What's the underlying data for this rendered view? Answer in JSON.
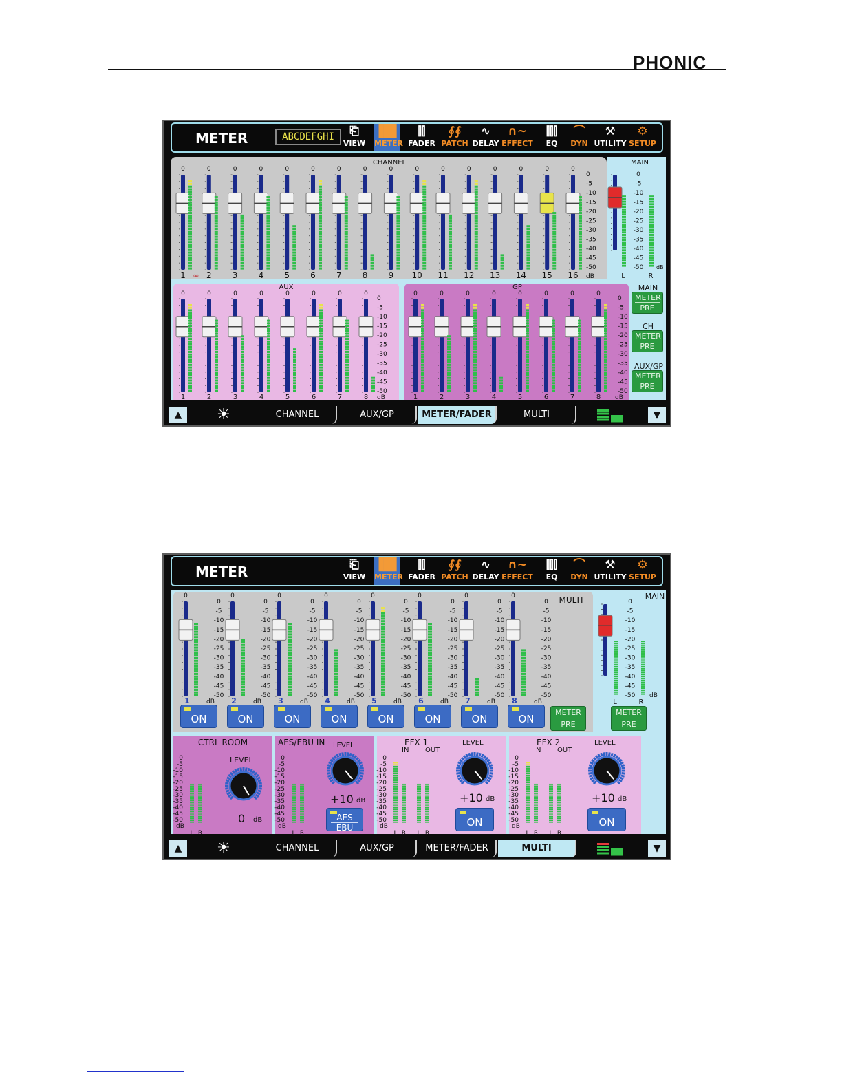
{
  "brand": "PHONIC",
  "toolbar": {
    "title": "METER",
    "channel_name": "ABCDEFGHI",
    "items": [
      {
        "label": "VIEW",
        "icon": "view-icon"
      },
      {
        "label": "METER",
        "icon": "meter-icon"
      },
      {
        "label": "FADER",
        "icon": "fader-icon"
      },
      {
        "label": "PATCH",
        "icon": "patch-icon"
      },
      {
        "label": "DELAY",
        "icon": "delay-icon"
      },
      {
        "label": "EFFECT",
        "icon": "effect-icon"
      },
      {
        "label": "EQ",
        "icon": "eq-icon"
      },
      {
        "label": "DYN",
        "icon": "dyn-icon"
      },
      {
        "label": "UTILITY",
        "icon": "utility-icon"
      },
      {
        "label": "SETUP",
        "icon": "setup-icon"
      }
    ],
    "active": "METER"
  },
  "tabs": [
    "CHANNEL",
    "AUX/GP",
    "METER/FADER",
    "MULTI"
  ],
  "scale": [
    "0",
    "-5",
    "-10",
    "-15",
    "-20",
    "-25",
    "-30",
    "-35",
    "-40",
    "-45",
    "-50"
  ],
  "db_label": "dB",
  "fader_top_value": "0",
  "screen1": {
    "active_tab": "METER/FADER",
    "channel": {
      "title": "CHANNEL",
      "channels": [
        "1",
        "2",
        "3",
        "4",
        "5",
        "6",
        "7",
        "8",
        "9",
        "10",
        "11",
        "12",
        "13",
        "14",
        "15",
        "16"
      ],
      "fader_levels": [
        0.7,
        0.7,
        0.7,
        0.7,
        0.7,
        0.7,
        0.7,
        0.7,
        0.7,
        0.7,
        0.7,
        0.7,
        0.7,
        0.7,
        0.7,
        0.7
      ],
      "meter_levels": [
        0.95,
        0.78,
        0.58,
        0.78,
        0.48,
        0.95,
        0.78,
        0.18,
        0.78,
        0.95,
        0.58,
        0.95,
        0.18,
        0.48,
        0.62,
        0.78
      ],
      "link_icon": "link-icon",
      "selected": "15"
    },
    "main": {
      "title": "MAIN",
      "fader_level": 0.7,
      "meter_levels": [
        0.78,
        0.78
      ],
      "lr": [
        "L",
        "R"
      ]
    },
    "aux": {
      "title": "AUX",
      "channels": [
        "1",
        "2",
        "3",
        "4",
        "5",
        "6",
        "7",
        "8"
      ],
      "fader_levels": [
        0.7,
        0.7,
        0.7,
        0.7,
        0.7,
        0.7,
        0.7,
        0.7
      ],
      "meter_levels": [
        0.95,
        0.78,
        0.6,
        0.78,
        0.48,
        0.95,
        0.78,
        0.18
      ]
    },
    "gp": {
      "title": "GP",
      "channels": [
        "1",
        "2",
        "3",
        "4",
        "5",
        "6",
        "7",
        "8"
      ],
      "fader_levels": [
        0.7,
        0.7,
        0.7,
        0.7,
        0.7,
        0.7,
        0.7,
        0.7
      ],
      "meter_levels": [
        0.95,
        0.6,
        0.95,
        0.18,
        0.95,
        0.78,
        0.78,
        0.95
      ]
    },
    "side_buttons": [
      {
        "label": "MAIN",
        "top": "METER",
        "bottom": "PRE"
      },
      {
        "label": "CH",
        "top": "METER",
        "bottom": "PRE"
      },
      {
        "label": "AUX/GP",
        "top": "METER",
        "bottom": "PRE"
      }
    ]
  },
  "screen2": {
    "active_tab": "MULTI",
    "multi": {
      "title": "MULTI",
      "channels": [
        "1",
        "2",
        "3",
        "4",
        "5",
        "6",
        "7",
        "8"
      ],
      "fader_levels": [
        0.7,
        0.7,
        0.7,
        0.7,
        0.7,
        0.7,
        0.7,
        0.7
      ],
      "meter_levels": [
        0.78,
        0.6,
        0.78,
        0.5,
        0.95,
        0.78,
        0.2,
        0.5
      ],
      "on_label": "ON",
      "meter_pre": {
        "top": "METER",
        "bottom": "PRE"
      }
    },
    "main": {
      "title": "MAIN",
      "fader_level": 0.7,
      "meter_levels": [
        0.78,
        0.78
      ],
      "lr": [
        "L",
        "R"
      ],
      "meter_pre": {
        "top": "METER",
        "bottom": "PRE"
      }
    },
    "ctrl_room": {
      "title": "CTRL ROOM",
      "level_label": "LEVEL",
      "value": "0",
      "unit": "dB",
      "meters": [
        0.6,
        0.6
      ],
      "lr": [
        "L",
        "R"
      ]
    },
    "aes": {
      "title": "AES/EBU IN",
      "level_label": "LEVEL",
      "value": "+10",
      "unit": "dB",
      "meters": [
        0.6,
        0.6
      ],
      "lr": [
        "L",
        "R"
      ],
      "button": [
        "AES",
        "EBU"
      ]
    },
    "efx1": {
      "title": "EFX 1",
      "in_label": "IN",
      "out_label": "OUT",
      "level_label": "LEVEL",
      "value": "+10",
      "unit": "dB",
      "meters": [
        0.95,
        0.6,
        0.6,
        0.6
      ],
      "lr": [
        "L",
        "R",
        "L",
        "R"
      ],
      "on_label": "ON"
    },
    "efx2": {
      "title": "EFX 2",
      "in_label": "IN",
      "out_label": "OUT",
      "level_label": "LEVEL",
      "value": "+10",
      "unit": "dB",
      "meters": [
        0.95,
        0.6,
        0.6,
        0.6
      ],
      "lr": [
        "L",
        "R",
        "L",
        "R"
      ],
      "on_label": "ON"
    }
  }
}
